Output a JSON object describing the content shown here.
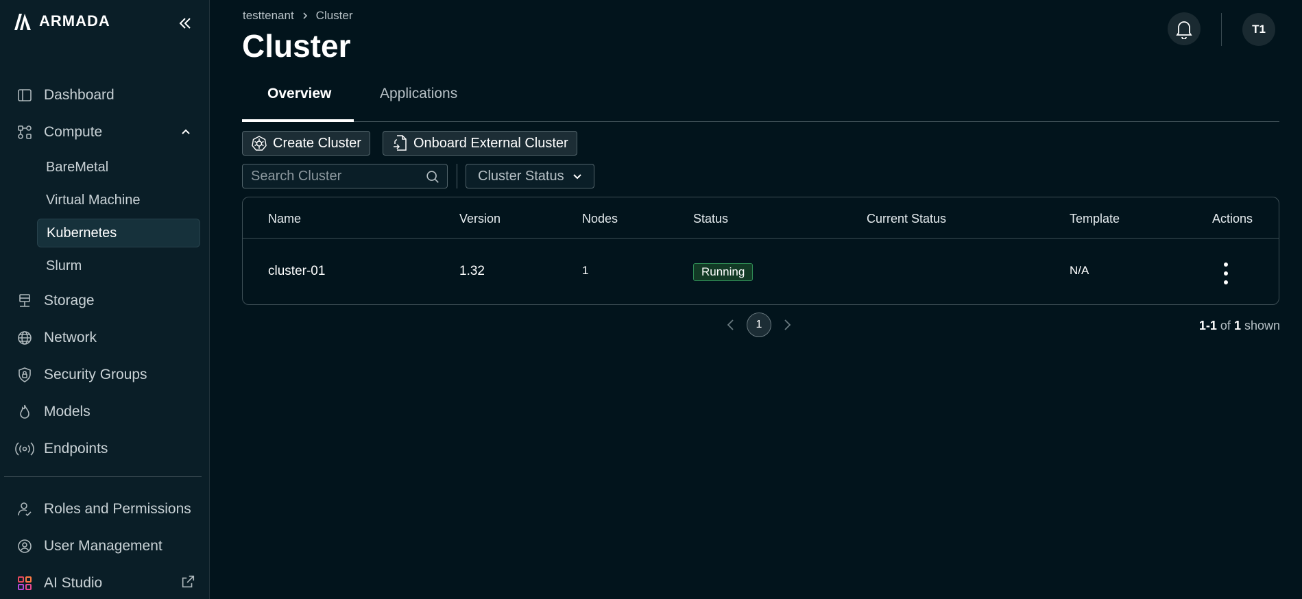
{
  "brand": {
    "name": "ARMADA"
  },
  "sidebar": {
    "items": [
      {
        "label": "Dashboard"
      },
      {
        "label": "Compute"
      },
      {
        "label": "BareMetal"
      },
      {
        "label": "Virtual Machine"
      },
      {
        "label": "Kubernetes"
      },
      {
        "label": "Slurm"
      },
      {
        "label": "Storage"
      },
      {
        "label": "Network"
      },
      {
        "label": "Security Groups"
      },
      {
        "label": "Models"
      },
      {
        "label": "Endpoints"
      }
    ],
    "bottom": [
      {
        "label": "Roles and Permissions"
      },
      {
        "label": "User Management"
      },
      {
        "label": "AI Studio"
      }
    ]
  },
  "header": {
    "breadcrumb": [
      "testtenant",
      "Cluster"
    ],
    "title": "Cluster",
    "avatar": "T1"
  },
  "tabs": [
    {
      "label": "Overview",
      "active": true
    },
    {
      "label": "Applications",
      "active": false
    }
  ],
  "toolbar": {
    "create_label": "Create Cluster",
    "onboard_label": "Onboard External Cluster",
    "search_placeholder": "Search Cluster",
    "status_filter": "Cluster Status"
  },
  "table": {
    "columns": [
      "Name",
      "Version",
      "Nodes",
      "Status",
      "Current Status",
      "Template",
      "Actions"
    ],
    "rows": [
      {
        "name": "cluster-01",
        "version": "1.32",
        "nodes": "1",
        "status": "Running",
        "current_status": "",
        "template": "N/A"
      }
    ]
  },
  "pagination": {
    "page": "1",
    "range": "1-1",
    "of": "of",
    "total": "1",
    "suffix": "shown"
  },
  "colors": {
    "background": "#02141c",
    "sidebar": "#0a1e27",
    "running_badge": "#2e8a54"
  }
}
